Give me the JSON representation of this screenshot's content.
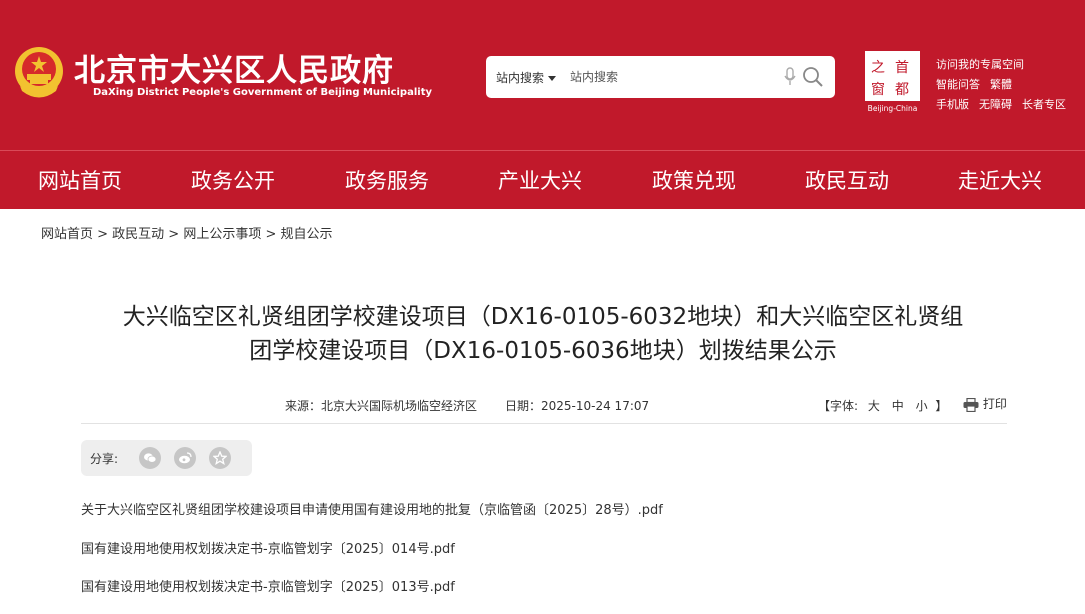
{
  "header": {
    "site_title": "北京市大兴区人民政府",
    "site_subtitle": "DaXing District People's Government of Beijing Municipality",
    "emblem_icon": "national-emblem-icon",
    "brand_color": "#c1192b",
    "search": {
      "scope": "站内搜索",
      "placeholder": "站内搜索"
    },
    "capital_logo": {
      "chars": [
        "之",
        "首",
        "窗",
        "都"
      ],
      "caption": "Beijing-China"
    },
    "quick_links": {
      "row1": [
        "访问我的专属空间"
      ],
      "row2": [
        "智能问答",
        "繁體"
      ],
      "row3": [
        "手机版",
        "无障碍",
        "长者专区"
      ]
    }
  },
  "nav": {
    "items": [
      "网站首页",
      "政务公开",
      "政务服务",
      "产业大兴",
      "政策兑现",
      "政民互动",
      "走近大兴"
    ]
  },
  "breadcrumb": "网站首页 > 政民互动 > 网上公示事项 > 规自公示",
  "article": {
    "title_line1": "大兴临空区礼贤组团学校建设项目（DX16-0105-6032地块）和大兴临空区礼贤组",
    "title_line2": "团学校建设项目（DX16-0105-6036地块）划拨结果公示",
    "source": "来源：北京大兴国际机场临空经济区",
    "date": "日期：2025-10-24 17:07",
    "font_size": {
      "label": "【字体:",
      "large": "大",
      "medium": "中",
      "small": "小",
      "end": "】"
    },
    "print": "打印",
    "share_label": "分享:",
    "files": [
      "关于大兴临空区礼贤组团学校建设项目申请使用国有建设用地的批复（京临管函〔2025〕28号）.pdf",
      "国有建设用地使用权划拨决定书-京临管划字〔2025〕014号.pdf",
      "国有建设用地使用权划拨决定书-京临管划字〔2025〕013号.pdf"
    ]
  }
}
